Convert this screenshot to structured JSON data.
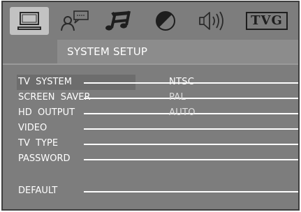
{
  "tabs": [
    {
      "name": "system-setup",
      "icon": "monitor-icon",
      "active": true
    },
    {
      "name": "language",
      "icon": "language-speech-icon",
      "active": false
    },
    {
      "name": "audio",
      "icon": "music-note-icon",
      "active": false
    },
    {
      "name": "video",
      "icon": "contrast-icon",
      "active": false
    },
    {
      "name": "speaker",
      "icon": "speaker-icon",
      "active": false
    },
    {
      "name": "tvg",
      "icon": "tvg-icon",
      "label": "TVG",
      "active": false
    }
  ],
  "page_title": "SYSTEM SETUP",
  "menu": {
    "items": [
      {
        "label": "TV  SYSTEM",
        "selected": true
      },
      {
        "label": "SCREEN  SAVER",
        "selected": false
      },
      {
        "label": "HD  OUTPUT",
        "selected": false
      },
      {
        "label": "VIDEO",
        "selected": false
      },
      {
        "label": "TV  TYPE",
        "selected": false
      },
      {
        "label": "PASSWORD",
        "selected": false
      },
      {
        "label": "DEFAULT",
        "selected": false
      }
    ]
  },
  "options": {
    "items": [
      {
        "label": "NTSC",
        "current": true
      },
      {
        "label": "PAL",
        "current": false
      },
      {
        "label": "AUTO",
        "current": false
      }
    ]
  },
  "colors": {
    "background": "#7d7d7d",
    "title_bar": "#8c8c8c",
    "active_tab": "#c2c2c2",
    "text": "#ffffff"
  }
}
